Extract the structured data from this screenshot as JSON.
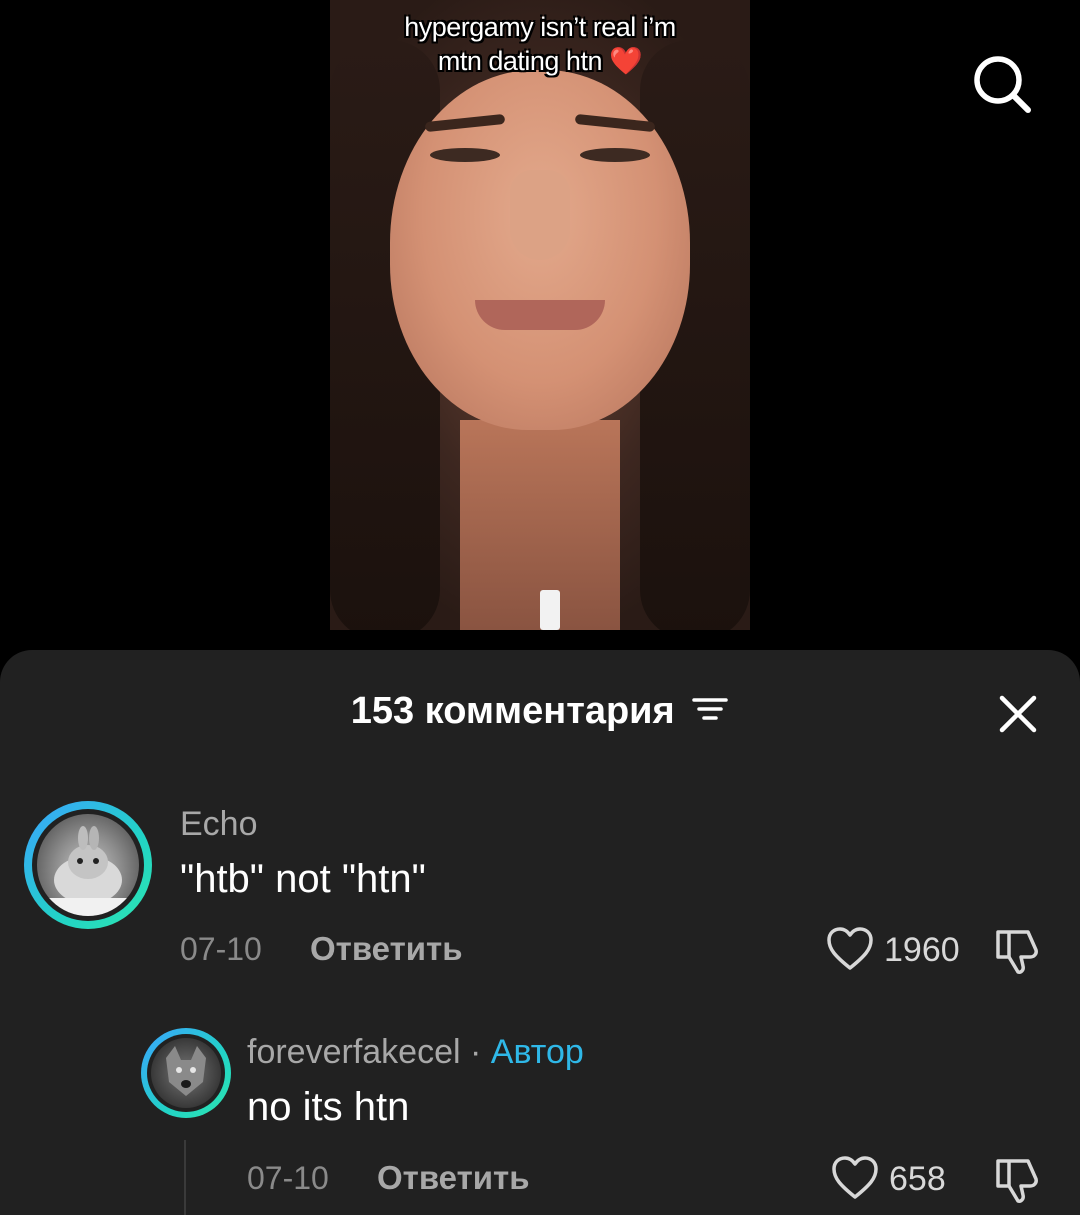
{
  "video": {
    "caption_line1": "hypergamy isn’t real i’m",
    "caption_line2": "mtn dating htn",
    "caption_emoji": "❤️",
    "search_icon": "search-icon"
  },
  "comments_sheet": {
    "title": "153 комментария",
    "sort_icon": "sort-lines-icon",
    "close_icon": "close-icon",
    "comments": [
      {
        "username": "Echo",
        "text": "\"htb\" not \"htn\"",
        "date": "07-10",
        "reply_label": "Ответить",
        "likes": "1960"
      },
      {
        "username": "foreverfakecel",
        "separator": " · ",
        "author_badge": "Автор",
        "text": "no its htn",
        "date": "07-10",
        "reply_label": "Ответить",
        "likes": "658"
      }
    ]
  },
  "colors": {
    "sheet_bg": "#212121",
    "author_accent": "#2fb8e8",
    "avatar_ring_start": "#3ba3ff",
    "avatar_ring_end": "#2ee6b0"
  }
}
